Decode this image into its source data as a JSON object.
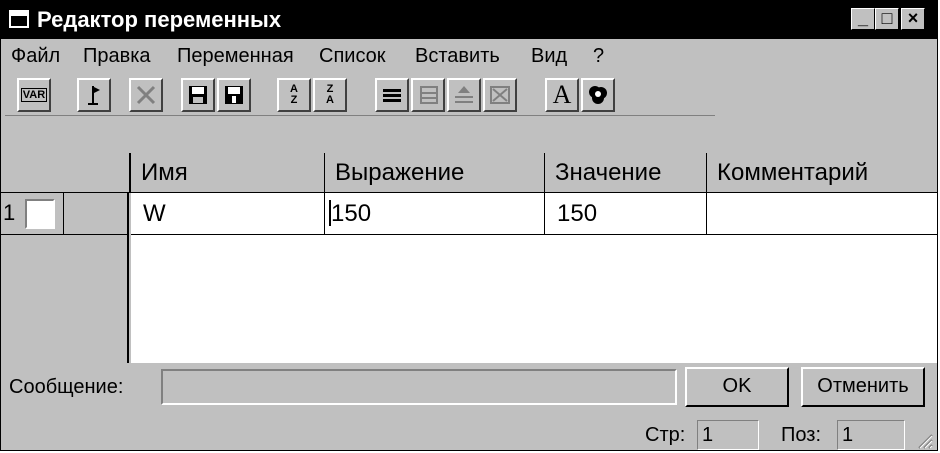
{
  "window": {
    "title": "Редактор переменных",
    "controls": [
      "_",
      "□",
      "×"
    ]
  },
  "menu": [
    {
      "label": "Файл"
    },
    {
      "label": "Правка"
    },
    {
      "label": "Переменная"
    },
    {
      "label": "Список"
    },
    {
      "label": "Вставить"
    },
    {
      "label": "Вид"
    },
    {
      "label": "?"
    }
  ],
  "toolbar": {
    "var_label": "VAR",
    "font_label": "A",
    "sort_az_label": "A Z",
    "sort_za_label": "Z A"
  },
  "table": {
    "columns": [
      "Имя",
      "Выражение",
      "Значение",
      "Комментарий"
    ],
    "rows": [
      {
        "num": "1",
        "name": "W",
        "expression": "150",
        "value": "150",
        "comment": ""
      }
    ]
  },
  "message": {
    "label": "Сообщение:",
    "value": ""
  },
  "buttons": {
    "ok": "OK",
    "cancel": "Отменить"
  },
  "status": {
    "page_label": "Стр:",
    "page_value": "1",
    "pos_label": "Поз:",
    "pos_value": "1"
  }
}
